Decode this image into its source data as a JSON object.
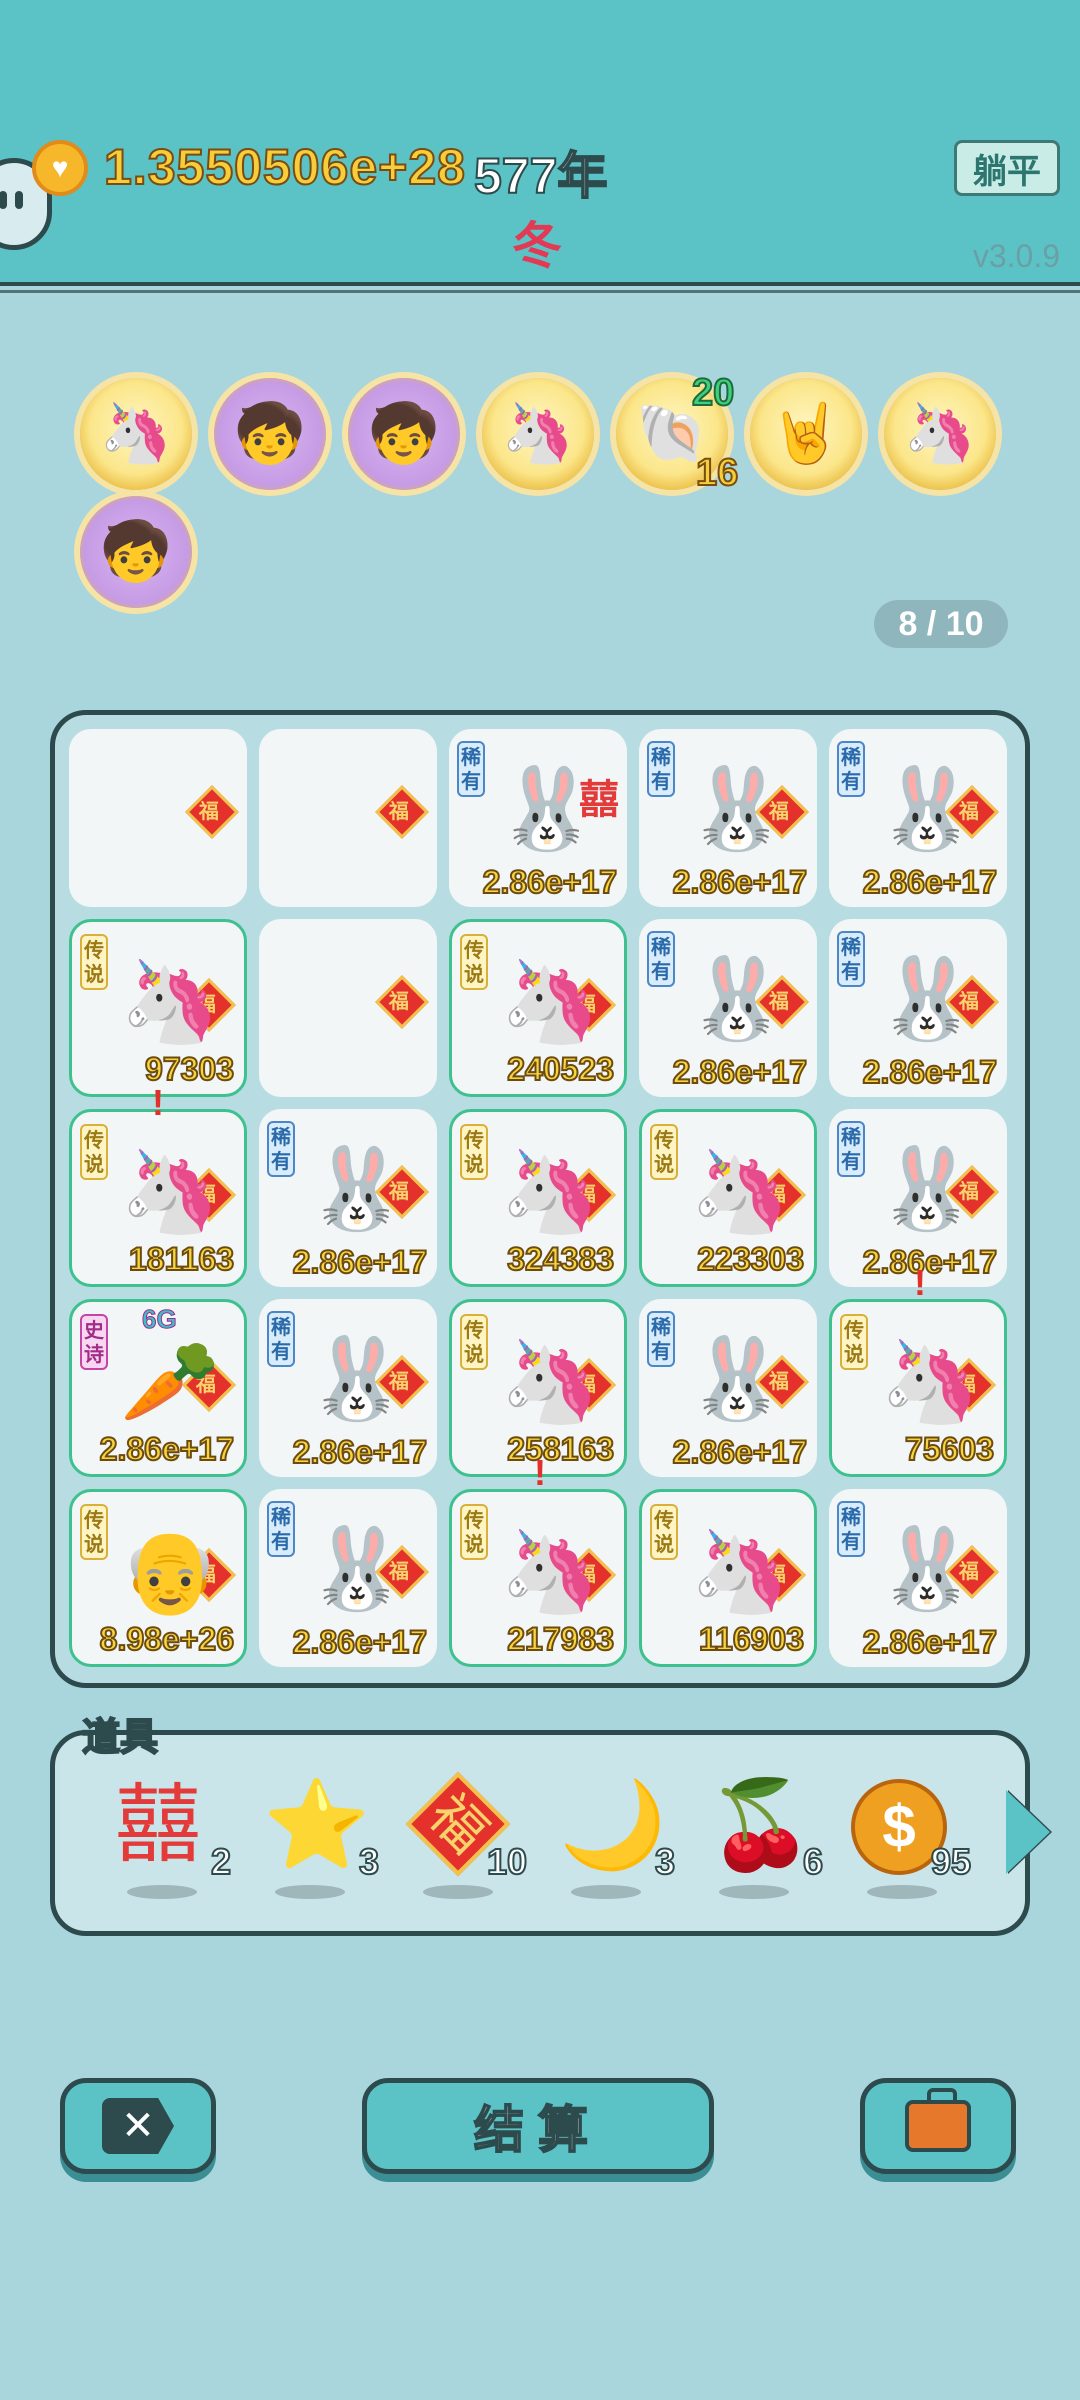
{
  "header": {
    "money": "1.3550506e+28",
    "year": "577年",
    "season": "冬",
    "lie_flat_label": "躺平",
    "version": "v3.0.9"
  },
  "medals": {
    "items": [
      "unicorn",
      "math-kid",
      "math-kid",
      "unicorn",
      "shell",
      "rock-hand",
      "unicorn",
      "math-kid"
    ],
    "shell_count_top": "20",
    "shell_count_bottom": "16"
  },
  "page_count": "8 / 10",
  "board": {
    "cells": [
      {
        "tag": "",
        "char": "",
        "value": ""
      },
      {
        "tag": "",
        "char": "",
        "value": ""
      },
      {
        "tag": "稀有",
        "char": "rabbit",
        "value": "2.86e+17"
      },
      {
        "tag": "稀有",
        "char": "rabbit",
        "value": "2.86e+17"
      },
      {
        "tag": "稀有",
        "char": "rabbit",
        "value": "2.86e+17"
      },
      {
        "tag": "传说",
        "char": "unicorn",
        "value": "97303"
      },
      {
        "tag": "",
        "char": "",
        "value": ""
      },
      {
        "tag": "传说",
        "char": "unicorn",
        "value": "240523"
      },
      {
        "tag": "稀有",
        "char": "rabbit",
        "value": "2.86e+17"
      },
      {
        "tag": "稀有",
        "char": "rabbit",
        "value": "2.86e+17"
      },
      {
        "tag": "传说",
        "char": "unicorn",
        "value": "181163"
      },
      {
        "tag": "稀有",
        "char": "rabbit",
        "value": "2.86e+17"
      },
      {
        "tag": "传说",
        "char": "unicorn",
        "value": "324383"
      },
      {
        "tag": "传说",
        "char": "unicorn",
        "value": "223303"
      },
      {
        "tag": "稀有",
        "char": "rabbit",
        "value": "2.86e+17"
      },
      {
        "tag": "史诗",
        "char": "carrot",
        "value": "2.86e+17"
      },
      {
        "tag": "稀有",
        "char": "rabbit",
        "value": "2.86e+17"
      },
      {
        "tag": "传说",
        "char": "unicorn",
        "value": "258163"
      },
      {
        "tag": "稀有",
        "char": "rabbit",
        "value": "2.86e+17"
      },
      {
        "tag": "传说",
        "char": "unicorn",
        "value": "75603"
      },
      {
        "tag": "传说",
        "char": "old-man",
        "value": "8.98e+26"
      },
      {
        "tag": "稀有",
        "char": "rabbit",
        "value": "2.86e+17"
      },
      {
        "tag": "传说",
        "char": "unicorn",
        "value": "217983"
      },
      {
        "tag": "传说",
        "char": "unicorn",
        "value": "116903"
      },
      {
        "tag": "稀有",
        "char": "rabbit",
        "value": "2.86e+17"
      }
    ],
    "fu_char": "福",
    "xi_char": "囍",
    "badge_6g": "6G"
  },
  "props": {
    "label": "道具",
    "items": [
      {
        "icon": "double-happiness-icon",
        "glyph": "囍",
        "count": "2"
      },
      {
        "icon": "star-icon",
        "glyph": "⭐",
        "count": "3"
      },
      {
        "icon": "fu-icon",
        "glyph": "福",
        "count": "10"
      },
      {
        "icon": "moon-icon",
        "glyph": "🌙",
        "count": "3"
      },
      {
        "icon": "lychee-icon",
        "glyph": "🍒",
        "count": "6"
      },
      {
        "icon": "coin-icon",
        "glyph": "$",
        "count": "95"
      }
    ]
  },
  "buttons": {
    "close_glyph": "✕",
    "settle_label": "结算"
  }
}
